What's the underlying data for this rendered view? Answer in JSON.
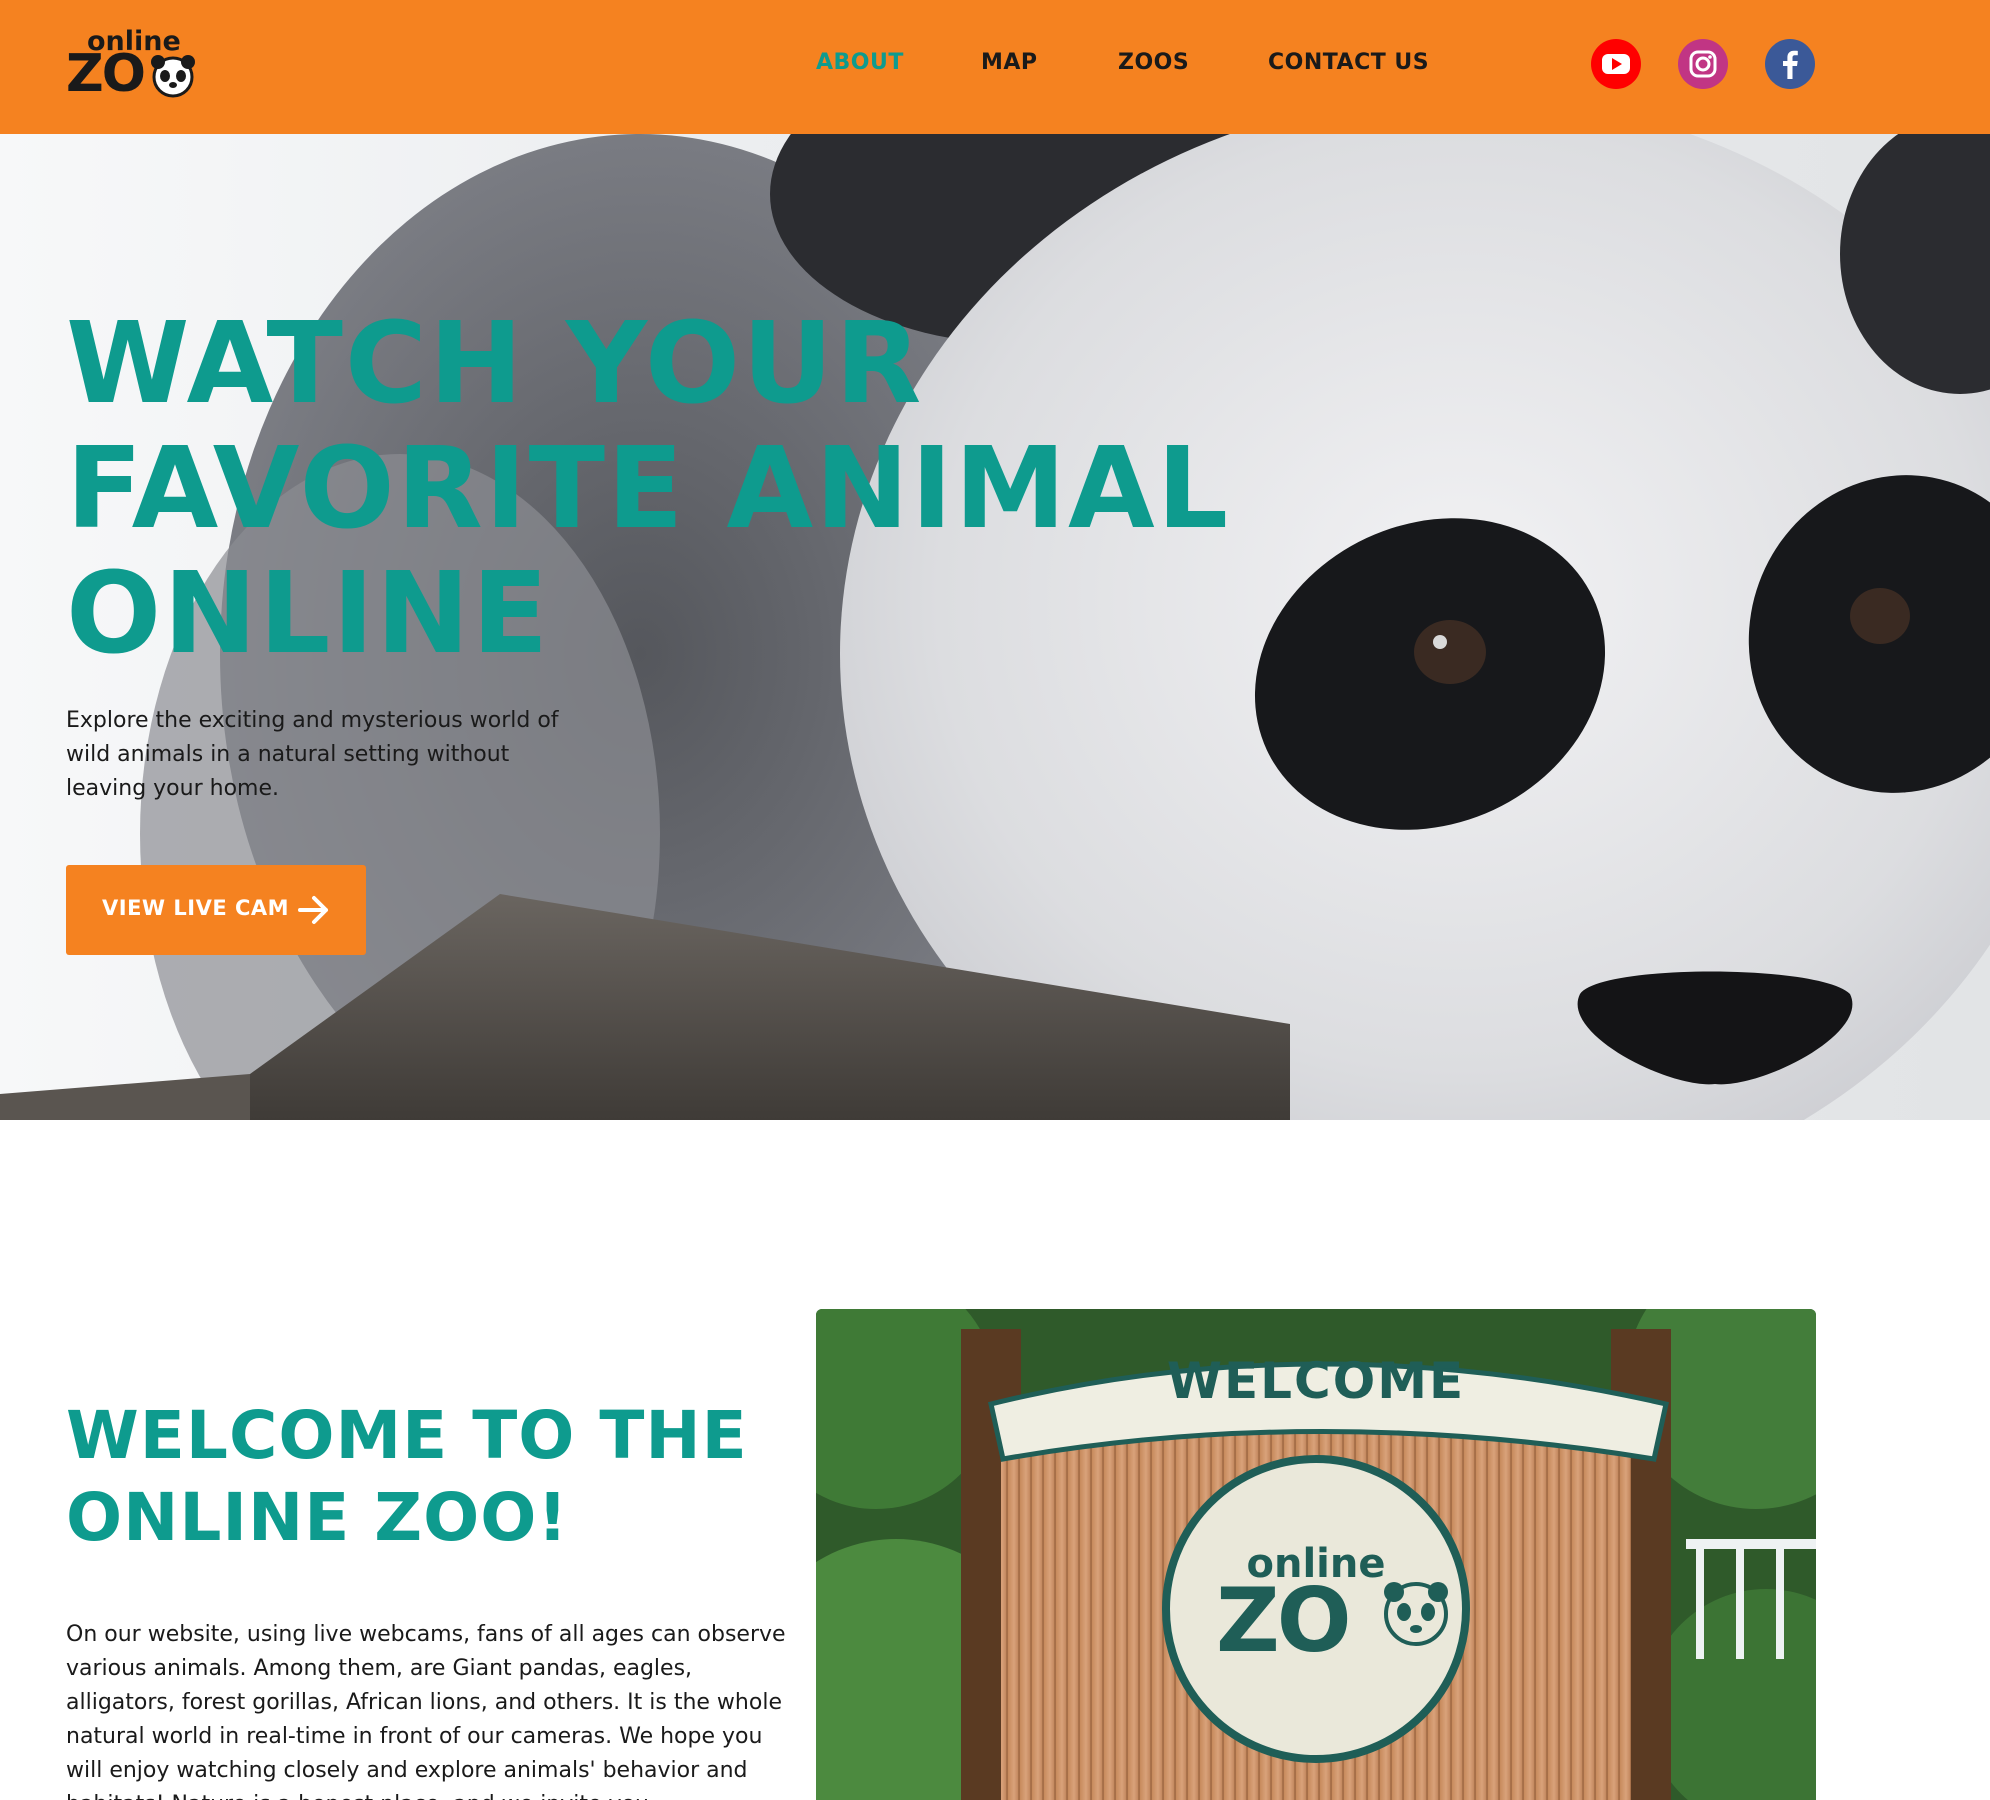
{
  "brand": {
    "logo_online": "online",
    "logo_zo": "ZO"
  },
  "nav": {
    "items": [
      {
        "label": "ABOUT",
        "active": true
      },
      {
        "label": "MAP",
        "active": false
      },
      {
        "label": "ZOOS",
        "active": false
      },
      {
        "label": "CONTACT US",
        "active": false
      }
    ]
  },
  "social": [
    {
      "icon": "youtube-icon",
      "color": "#ff0000"
    },
    {
      "icon": "instagram-icon",
      "color": "#c13584"
    },
    {
      "icon": "facebook-icon",
      "color": "#3b5998"
    }
  ],
  "hero": {
    "title_lines": [
      "WATCH YOUR",
      "FAVORITE ANIMAL",
      "ONLINE"
    ],
    "subtitle": "Explore the exciting and mysterious world of wild animals in a natural setting without leaving your home.",
    "cta_label": "VIEW LIVE CAM",
    "cta_icon": "arrow-right-icon"
  },
  "welcome": {
    "title_lines": [
      "WELCOME TO THE",
      "ONLINE ZOO!"
    ],
    "text": "On our website, using live webcams, fans of all ages can observe various animals. Among them, are Giant pandas, eagles, alligators, forest gorillas, African lions, and others. It is the whole natural world in real-time in front of our cameras. We hope you will enjoy watching closely and explore animals' behavior and habitats! Nature is a honest place, and we invite you",
    "sign_text": "WELCOME",
    "badge_online": "online",
    "badge_zo": "ZO"
  },
  "colors": {
    "accent_orange": "#f58220",
    "teal": "#0e9b8e",
    "dark_teal": "#1f5e57"
  }
}
